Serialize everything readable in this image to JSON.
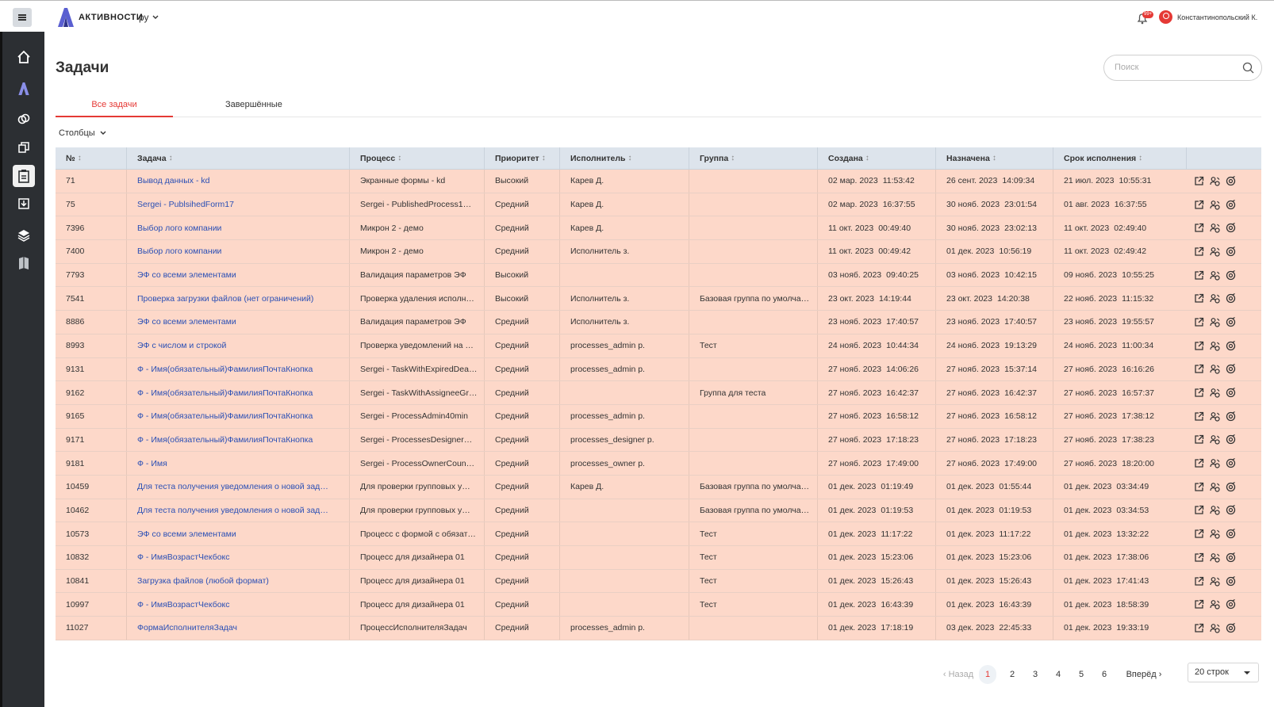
{
  "header": {
    "app_name": "АКТИВНОСТИ",
    "language": "ру",
    "notifications_badge": "99+",
    "user_name": "Константинопольский К."
  },
  "page": {
    "title": "Задачи",
    "search_placeholder": "Поиск",
    "tabs": [
      "Все задачи",
      "Завершённые"
    ],
    "columns_label": "Столбцы"
  },
  "table": {
    "columns": [
      "№",
      "Задача",
      "Процесс",
      "Приоритет",
      "Исполнитель",
      "Группа",
      "Создана",
      "Назначена",
      "Срок исполнения"
    ],
    "rows": [
      {
        "id": "71",
        "task": "Вывод данных - kd",
        "process": "Экранные формы - kd",
        "priority": "Высокий",
        "assignee": "Карев Д.",
        "group": "",
        "created_d": "02 мар. 2023",
        "created_t": "11:53:42",
        "assigned_d": "26 сент. 2023",
        "assigned_t": "14:09:34",
        "due_d": "21 июл. 2023",
        "due_t": "10:55:31"
      },
      {
        "id": "75",
        "task": "Sergei - PublsihedForm17",
        "process": "Sergei - PublishedProcess1…",
        "priority": "Средний",
        "assignee": "Карев Д.",
        "group": "",
        "created_d": "02 мар. 2023",
        "created_t": "16:37:55",
        "assigned_d": "30 нояб. 2023",
        "assigned_t": "23:01:54",
        "due_d": "01 авг. 2023",
        "due_t": "16:37:55"
      },
      {
        "id": "7396",
        "task": "Выбор лого компании",
        "process": "Микрон 2 - демо",
        "priority": "Средний",
        "assignee": "Карев Д.",
        "group": "",
        "created_d": "11 окт. 2023",
        "created_t": "00:49:40",
        "assigned_d": "30 нояб. 2023",
        "assigned_t": "23:02:13",
        "due_d": "11 окт. 2023",
        "due_t": "02:49:40"
      },
      {
        "id": "7400",
        "task": "Выбор лого компании",
        "process": "Микрон 2 - демо",
        "priority": "Средний",
        "assignee": "Исполнитель з.",
        "group": "",
        "created_d": "11 окт. 2023",
        "created_t": "00:49:42",
        "assigned_d": "01 дек. 2023",
        "assigned_t": "10:56:19",
        "due_d": "11 окт. 2023",
        "due_t": "02:49:42"
      },
      {
        "id": "7793",
        "task": "ЭФ со всеми элементами",
        "process": "Валидация параметров ЭФ",
        "priority": "Высокий",
        "assignee": "",
        "group": "",
        "created_d": "03 нояб. 2023",
        "created_t": "09:40:25",
        "assigned_d": "03 нояб. 2023",
        "assigned_t": "10:42:15",
        "due_d": "09 нояб. 2023",
        "due_t": "10:55:25"
      },
      {
        "id": "7541",
        "task": "Проверка загрузки файлов (нет ограничений)",
        "process": "Проверка удаления исполн…",
        "priority": "Высокий",
        "assignee": "Исполнитель з.",
        "group": "Базовая группа по умолча…",
        "created_d": "23 окт. 2023",
        "created_t": "14:19:44",
        "assigned_d": "23 окт. 2023",
        "assigned_t": "14:20:38",
        "due_d": "22 нояб. 2023",
        "due_t": "11:15:32"
      },
      {
        "id": "8886",
        "task": "ЭФ со всеми элементами",
        "process": "Валидация параметров ЭФ",
        "priority": "Средний",
        "assignee": "Исполнитель з.",
        "group": "",
        "created_d": "23 нояб. 2023",
        "created_t": "17:40:57",
        "assigned_d": "23 нояб. 2023",
        "assigned_t": "17:40:57",
        "due_d": "23 нояб. 2023",
        "due_t": "19:55:57"
      },
      {
        "id": "8993",
        "task": "ЭФ с числом и строкой",
        "process": "Проверка уведомлений на …",
        "priority": "Средний",
        "assignee": "processes_admin p.",
        "group": "Тест",
        "created_d": "24 нояб. 2023",
        "created_t": "10:44:34",
        "assigned_d": "24 нояб. 2023",
        "assigned_t": "19:13:29",
        "due_d": "24 нояб. 2023",
        "due_t": "11:00:34"
      },
      {
        "id": "9131",
        "task": "Ф - Имя(обязательный)ФамилияПочтаКнопка",
        "process": "Sergei - TaskWithExpiredDea…",
        "priority": "Средний",
        "assignee": "processes_admin p.",
        "group": "",
        "created_d": "27 нояб. 2023",
        "created_t": "14:06:26",
        "assigned_d": "27 нояб. 2023",
        "assigned_t": "15:37:14",
        "due_d": "27 нояб. 2023",
        "due_t": "16:16:26"
      },
      {
        "id": "9162",
        "task": "Ф - Имя(обязательный)ФамилияПочтаКнопка",
        "process": "Sergei - TaskWithAssigneeGr…",
        "priority": "Средний",
        "assignee": "",
        "group": "Группа для теста",
        "created_d": "27 нояб. 2023",
        "created_t": "16:42:37",
        "assigned_d": "27 нояб. 2023",
        "assigned_t": "16:42:37",
        "due_d": "27 нояб. 2023",
        "due_t": "16:57:37"
      },
      {
        "id": "9165",
        "task": "Ф - Имя(обязательный)ФамилияПочтаКнопка",
        "process": "Sergei - ProcessAdmin40min",
        "priority": "Средний",
        "assignee": "processes_admin p.",
        "group": "",
        "created_d": "27 нояб. 2023",
        "created_t": "16:58:12",
        "assigned_d": "27 нояб. 2023",
        "assigned_t": "16:58:12",
        "due_d": "27 нояб. 2023",
        "due_t": "17:38:12"
      },
      {
        "id": "9171",
        "task": "Ф - Имя(обязательный)ФамилияПочтаКнопка",
        "process": "Sergei - ProcessesDesigner…",
        "priority": "Средний",
        "assignee": "processes_designer p.",
        "group": "",
        "created_d": "27 нояб. 2023",
        "created_t": "17:18:23",
        "assigned_d": "27 нояб. 2023",
        "assigned_t": "17:18:23",
        "due_d": "27 нояб. 2023",
        "due_t": "17:38:23"
      },
      {
        "id": "9181",
        "task": "Ф - Имя",
        "process": "Sergei - ProcessOwnerCoun…",
        "priority": "Средний",
        "assignee": "processes_owner p.",
        "group": "",
        "created_d": "27 нояб. 2023",
        "created_t": "17:49:00",
        "assigned_d": "27 нояб. 2023",
        "assigned_t": "17:49:00",
        "due_d": "27 нояб. 2023",
        "due_t": "18:20:00"
      },
      {
        "id": "10459",
        "task": "Для теста получения уведомления о новой зад…",
        "process": "Для проверки групповых у…",
        "priority": "Средний",
        "assignee": "Карев Д.",
        "group": "Базовая группа по умолча…",
        "created_d": "01 дек. 2023",
        "created_t": "01:19:49",
        "assigned_d": "01 дек. 2023",
        "assigned_t": "01:55:44",
        "due_d": "01 дек. 2023",
        "due_t": "03:34:49"
      },
      {
        "id": "10462",
        "task": "Для теста получения уведомления о новой зад…",
        "process": "Для проверки групповых у…",
        "priority": "Средний",
        "assignee": "",
        "group": "Базовая группа по умолча…",
        "created_d": "01 дек. 2023",
        "created_t": "01:19:53",
        "assigned_d": "01 дек. 2023",
        "assigned_t": "01:19:53",
        "due_d": "01 дек. 2023",
        "due_t": "03:34:53"
      },
      {
        "id": "10573",
        "task": "ЭФ со всеми элементами",
        "process": "Процесс с формой с обязат…",
        "priority": "Средний",
        "assignee": "",
        "group": "Тест",
        "created_d": "01 дек. 2023",
        "created_t": "11:17:22",
        "assigned_d": "01 дек. 2023",
        "assigned_t": "11:17:22",
        "due_d": "01 дек. 2023",
        "due_t": "13:32:22"
      },
      {
        "id": "10832",
        "task": "Ф - ИмяВозрастЧекбокс",
        "process": "Процесс для дизайнера 01",
        "priority": "Средний",
        "assignee": "",
        "group": "Тест",
        "created_d": "01 дек. 2023",
        "created_t": "15:23:06",
        "assigned_d": "01 дек. 2023",
        "assigned_t": "15:23:06",
        "due_d": "01 дек. 2023",
        "due_t": "17:38:06"
      },
      {
        "id": "10841",
        "task": "Загрузка файлов (любой формат)",
        "process": "Процесс для дизайнера 01",
        "priority": "Средний",
        "assignee": "",
        "group": "Тест",
        "created_d": "01 дек. 2023",
        "created_t": "15:26:43",
        "assigned_d": "01 дек. 2023",
        "assigned_t": "15:26:43",
        "due_d": "01 дек. 2023",
        "due_t": "17:41:43"
      },
      {
        "id": "10997",
        "task": "Ф - ИмяВозрастЧекбокс",
        "process": "Процесс для дизайнера 01",
        "priority": "Средний",
        "assignee": "",
        "group": "Тест",
        "created_d": "01 дек. 2023",
        "created_t": "16:43:39",
        "assigned_d": "01 дек. 2023",
        "assigned_t": "16:43:39",
        "due_d": "01 дек. 2023",
        "due_t": "18:58:39"
      },
      {
        "id": "11027",
        "task": "ФормаИсполнителяЗадач",
        "process": "ПроцессИсполнителяЗадач",
        "priority": "Средний",
        "assignee": "processes_admin p.",
        "group": "",
        "created_d": "01 дек. 2023",
        "created_t": "17:18:19",
        "assigned_d": "03 дек. 2023",
        "assigned_t": "22:45:33",
        "due_d": "01 дек. 2023",
        "due_t": "19:33:19"
      }
    ]
  },
  "pagination": {
    "prev": "‹ Назад",
    "pages": [
      "1",
      "2",
      "3",
      "4",
      "5",
      "6"
    ],
    "current": "1",
    "next": "Вперёд ›",
    "rows_per_page": "20 строк"
  },
  "colors": {
    "accent": "#e53935",
    "row_highlight": "#fdd8c9",
    "header_bg": "#dde4ec",
    "link": "#2a4fb5",
    "sidebar": "#2c2f33"
  }
}
